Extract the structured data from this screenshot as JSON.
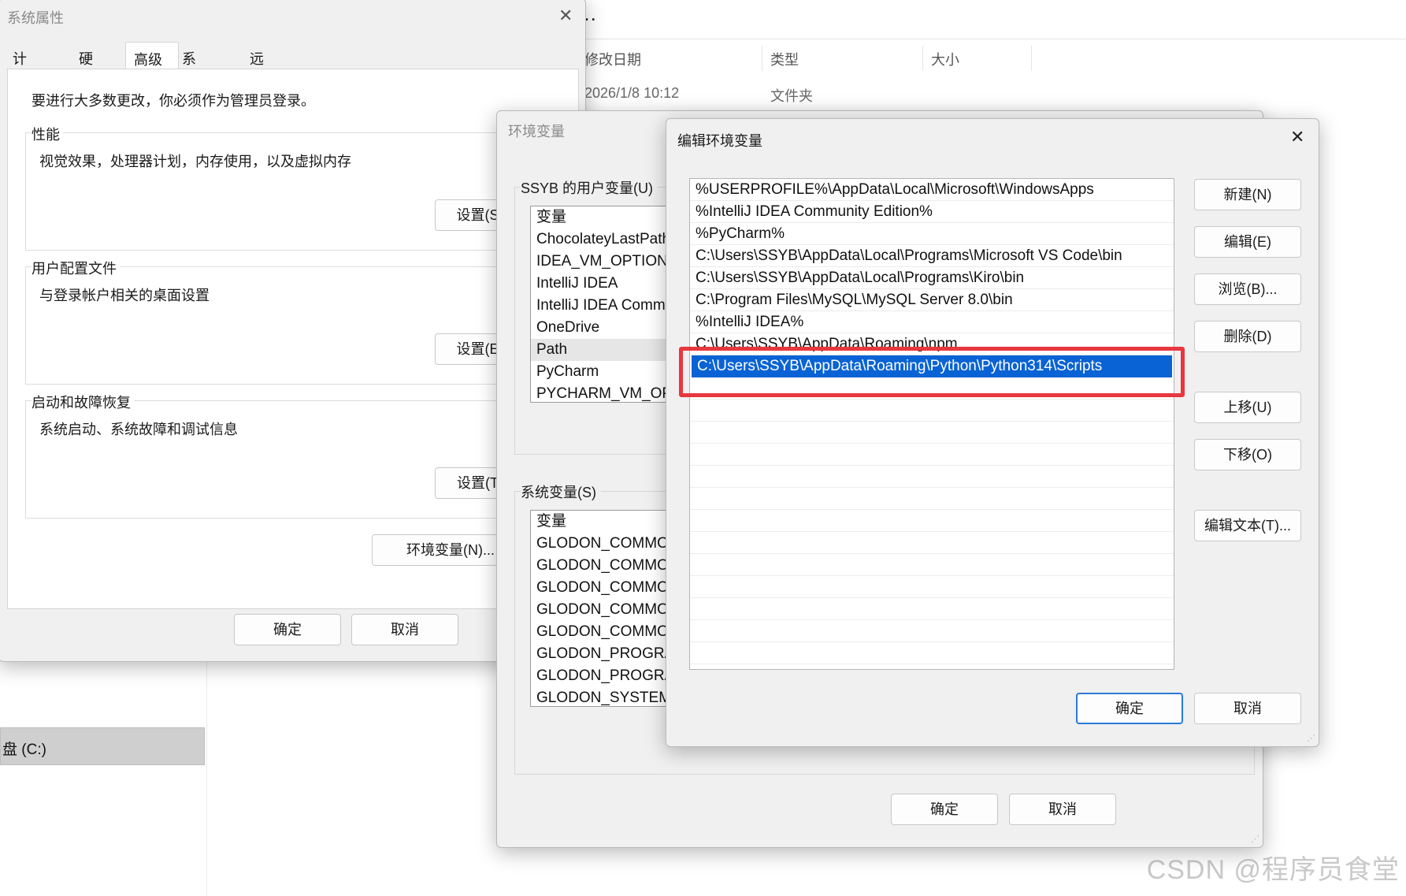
{
  "explorer": {
    "overflow_dots": "…",
    "columns": [
      "修改日期",
      "类型",
      "大小"
    ],
    "row": {
      "date": "2026/1/8 10:12",
      "type": "文件夹"
    },
    "drive": "盘 (C:)",
    "watermark": "CSDN @程序员食堂"
  },
  "system_properties": {
    "title": "系统属性",
    "tabs": [
      "计算机名",
      "硬件",
      "高级",
      "系统保护",
      "远程"
    ],
    "active_tab": "高级",
    "admin_note": "要进行大多数更改，你必须作为管理员登录。",
    "performance": {
      "legend": "性能",
      "desc": "视觉效果，处理器计划，内存使用，以及虚拟内存",
      "button": "设置(S)..."
    },
    "user_profiles": {
      "legend": "用户配置文件",
      "desc": "与登录帐户相关的桌面设置",
      "button": "设置(E)..."
    },
    "startup_recovery": {
      "legend": "启动和故障恢复",
      "desc": "系统启动、系统故障和调试信息",
      "button": "设置(T)..."
    },
    "env_button": "环境变量(N)...",
    "ok": "确定",
    "cancel": "取消"
  },
  "environment_variables": {
    "title": "环境变量",
    "user_section_label": "SSYB 的用户变量(U)",
    "user_vars_header": "变量",
    "user_vars": [
      "ChocolateyLastPathUpdate",
      "IDEA_VM_OPTIONS",
      "IntelliJ IDEA",
      "IntelliJ IDEA Community Edition",
      "OneDrive",
      "Path",
      "PyCharm",
      "PYCHARM_VM_OPTIONS"
    ],
    "user_vars_highlighted": "Path",
    "system_section_label": "系统变量(S)",
    "system_vars_header": "变量",
    "system_vars": [
      "GLODON_COMMON",
      "GLODON_COMMON",
      "GLODON_COMMON",
      "GLODON_COMMON",
      "GLODON_COMMON",
      "GLODON_PROGRAM",
      "GLODON_PROGRAM",
      "GLODON_SYSTEM"
    ],
    "ok": "确定",
    "cancel": "取消"
  },
  "edit_environment_variable": {
    "title": "编辑环境变量",
    "close_label": "✕",
    "entries": [
      "%USERPROFILE%\\AppData\\Local\\Microsoft\\WindowsApps",
      "%IntelliJ IDEA Community Edition%",
      "%PyCharm%",
      "C:\\Users\\SSYB\\AppData\\Local\\Programs\\Microsoft VS Code\\bin",
      "C:\\Users\\SSYB\\AppData\\Local\\Programs\\Kiro\\bin",
      "C:\\Program Files\\MySQL\\MySQL Server 8.0\\bin",
      "%IntelliJ IDEA%",
      "C:\\Users\\SSYB\\AppData\\Roaming\\npm",
      "C:\\Users\\SSYB\\AppData\\Roaming\\Python\\Python314\\Scripts"
    ],
    "selected_index": 8,
    "buttons": {
      "new": "新建(N)",
      "edit": "编辑(E)",
      "browse": "浏览(B)...",
      "delete": "删除(D)",
      "move_up": "上移(U)",
      "move_down": "下移(O)",
      "edit_text": "编辑文本(T)..."
    },
    "ok": "确定",
    "cancel": "取消"
  }
}
